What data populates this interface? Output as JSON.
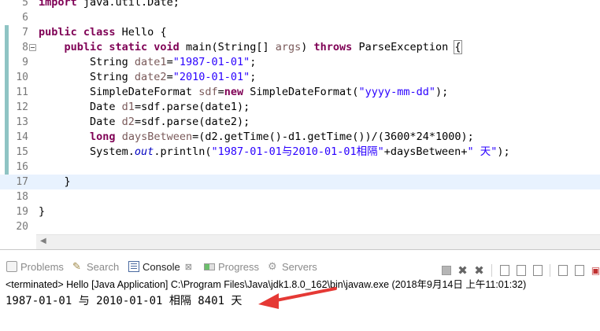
{
  "editor": {
    "lines": [
      {
        "no": "5",
        "tokens": [
          {
            "t": "kw",
            "v": "import"
          },
          {
            "t": "",
            "v": " java.util.Date;"
          }
        ]
      },
      {
        "no": "6",
        "tokens": []
      },
      {
        "no": "7",
        "tokens": [
          {
            "t": "kw",
            "v": "public class"
          },
          {
            "t": "",
            "v": " Hello {"
          }
        ]
      },
      {
        "no": "8",
        "fold": true,
        "tokens": [
          {
            "t": "",
            "v": "    "
          },
          {
            "t": "kw",
            "v": "public static void"
          },
          {
            "t": "",
            "v": " main(String[] "
          },
          {
            "t": "unused",
            "v": "args"
          },
          {
            "t": "",
            "v": ") "
          },
          {
            "t": "kw",
            "v": "throws"
          },
          {
            "t": "",
            "v": " ParseException "
          },
          {
            "t": "brace",
            "v": "{"
          }
        ]
      },
      {
        "no": "9",
        "tokens": [
          {
            "t": "",
            "v": "        String "
          },
          {
            "t": "unused",
            "v": "date1"
          },
          {
            "t": "",
            "v": "="
          },
          {
            "t": "str",
            "v": "\"1987-01-01\""
          },
          {
            "t": "",
            "v": ";"
          }
        ]
      },
      {
        "no": "10",
        "tokens": [
          {
            "t": "",
            "v": "        String "
          },
          {
            "t": "unused",
            "v": "date2"
          },
          {
            "t": "",
            "v": "="
          },
          {
            "t": "str",
            "v": "\"2010-01-01\""
          },
          {
            "t": "",
            "v": ";"
          }
        ]
      },
      {
        "no": "11",
        "tokens": [
          {
            "t": "",
            "v": "        SimpleDateFormat "
          },
          {
            "t": "unused",
            "v": "sdf"
          },
          {
            "t": "",
            "v": "="
          },
          {
            "t": "kw",
            "v": "new"
          },
          {
            "t": "",
            "v": " SimpleDateFormat("
          },
          {
            "t": "str",
            "v": "\"yyyy-mm-dd\""
          },
          {
            "t": "",
            "v": ");"
          }
        ]
      },
      {
        "no": "12",
        "tokens": [
          {
            "t": "",
            "v": "        Date "
          },
          {
            "t": "unused",
            "v": "d1"
          },
          {
            "t": "",
            "v": "=sdf.parse(date1);"
          }
        ]
      },
      {
        "no": "13",
        "tokens": [
          {
            "t": "",
            "v": "        Date "
          },
          {
            "t": "unused",
            "v": "d2"
          },
          {
            "t": "",
            "v": "=sdf.parse(date2);"
          }
        ]
      },
      {
        "no": "14",
        "tokens": [
          {
            "t": "",
            "v": "        "
          },
          {
            "t": "kw",
            "v": "long"
          },
          {
            "t": "",
            "v": " "
          },
          {
            "t": "unused",
            "v": "daysBetween"
          },
          {
            "t": "",
            "v": "=(d2.getTime()-d1.getTime())/(3600*24*1000);"
          }
        ]
      },
      {
        "no": "15",
        "tokens": [
          {
            "t": "",
            "v": "        System."
          },
          {
            "t": "fld",
            "v": "out"
          },
          {
            "t": "",
            "v": ".println("
          },
          {
            "t": "str",
            "v": "\"1987-01-01与2010-01-01相隔\""
          },
          {
            "t": "",
            "v": "+daysBetween+"
          },
          {
            "t": "str",
            "v": "\" 天\""
          },
          {
            "t": "",
            "v": ");"
          }
        ]
      },
      {
        "no": "16",
        "tokens": []
      },
      {
        "no": "17",
        "current": true,
        "tokens": [
          {
            "t": "",
            "v": "    }"
          }
        ]
      },
      {
        "no": "18",
        "tokens": []
      },
      {
        "no": "19",
        "tokens": [
          {
            "t": "",
            "v": "}"
          }
        ]
      },
      {
        "no": "20",
        "tokens": []
      }
    ]
  },
  "console": {
    "tabs": [
      {
        "id": "problems",
        "label": "Problems",
        "icon": "problems-icon"
      },
      {
        "id": "search",
        "label": "Search",
        "icon": "search-icon"
      },
      {
        "id": "console",
        "label": "Console",
        "icon": "console-icon",
        "close": "⊠"
      },
      {
        "id": "progress",
        "label": "Progress",
        "icon": "progress-icon"
      },
      {
        "id": "servers",
        "label": "Servers",
        "icon": "servers-icon"
      }
    ],
    "status": "<terminated> Hello [Java Application] C:\\Program Files\\Java\\jdk1.8.0_162\\bin\\javaw.exe (2018年9月14日 上午11:01:32)",
    "output": "1987-01-01 与 2010-01-01 相隔 8401 天"
  },
  "colors": {
    "keyword": "#7f0055",
    "string": "#2a00ff",
    "field": "#0000c0",
    "arrow": "#e53935"
  }
}
